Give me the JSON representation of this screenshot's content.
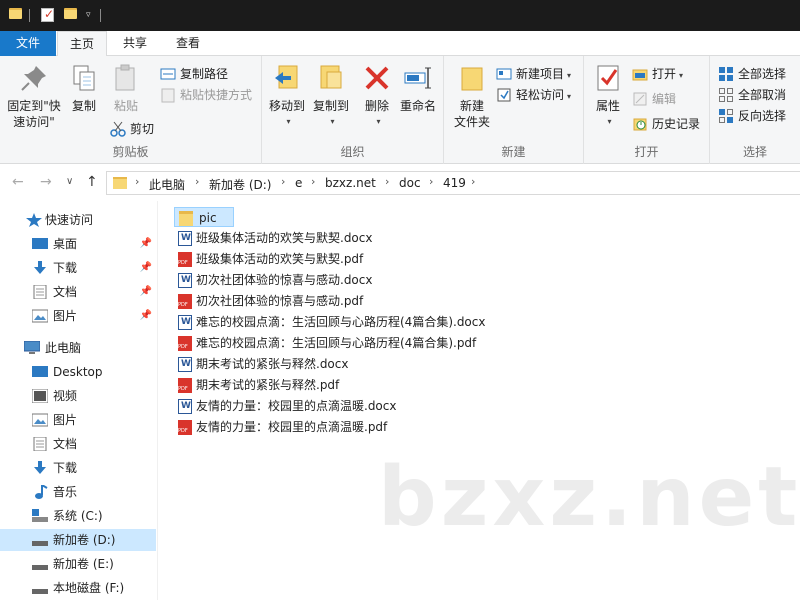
{
  "tabs": {
    "file": "文件",
    "home": "主页",
    "share": "共享",
    "view": "查看"
  },
  "ribbon": {
    "clipboard": {
      "label": "剪贴板",
      "pin_quick": "固定到\"快\n速访问\"",
      "copy": "复制",
      "paste": "粘贴",
      "copy_path": "复制路径",
      "paste_shortcut": "粘贴快捷方式",
      "cut": "剪切"
    },
    "organize": {
      "label": "组织",
      "move_to": "移动到",
      "copy_to": "复制到",
      "delete": "删除",
      "rename": "重命名"
    },
    "new": {
      "label": "新建",
      "new_folder": "新建\n文件夹",
      "new_item": "新建项目",
      "easy_access": "轻松访问"
    },
    "open": {
      "label": "打开",
      "properties": "属性",
      "open": "打开",
      "edit": "编辑",
      "history": "历史记录"
    },
    "select": {
      "label": "选择",
      "select_all": "全部选择",
      "select_none": "全部取消",
      "invert": "反向选择"
    }
  },
  "address": {
    "crumbs": [
      "此电脑",
      "新加卷 (D:)",
      "e",
      "bzxz.net",
      "doc",
      "419"
    ]
  },
  "nav": {
    "quick_access": "快速访问",
    "desktop": "桌面",
    "downloads": "下载",
    "documents": "文档",
    "pictures": "图片",
    "this_pc": "此电脑",
    "pc_desktop": "Desktop",
    "videos": "视频",
    "pc_pictures": "图片",
    "pc_documents": "文档",
    "pc_downloads": "下载",
    "music": "音乐",
    "drive_c": "系统 (C:)",
    "drive_d": "新加卷 (D:)",
    "drive_e": "新加卷 (E:)",
    "drive_f": "本地磁盘 (F:)"
  },
  "files": [
    {
      "name": "pic",
      "type": "folder"
    },
    {
      "name": "班级集体活动的欢笑与默契.docx",
      "type": "docx"
    },
    {
      "name": "班级集体活动的欢笑与默契.pdf",
      "type": "pdf"
    },
    {
      "name": "初次社团体验的惊喜与感动.docx",
      "type": "docx"
    },
    {
      "name": "初次社团体验的惊喜与感动.pdf",
      "type": "pdf"
    },
    {
      "name": "难忘的校园点滴：生活回顾与心路历程(4篇合集).docx",
      "type": "docx"
    },
    {
      "name": "难忘的校园点滴：生活回顾与心路历程(4篇合集).pdf",
      "type": "pdf"
    },
    {
      "name": "期末考试的紧张与释然.docx",
      "type": "docx"
    },
    {
      "name": "期末考试的紧张与释然.pdf",
      "type": "pdf"
    },
    {
      "name": "友情的力量：校园里的点滴温暖.docx",
      "type": "docx"
    },
    {
      "name": "友情的力量：校园里的点滴温暖.pdf",
      "type": "pdf"
    }
  ],
  "watermark": "bzxz.net",
  "colors": {
    "accent": "#1979ca",
    "selection": "#cce8ff",
    "folder": "#f7d774",
    "pdf": "#d9342b",
    "word": "#2b5797"
  }
}
